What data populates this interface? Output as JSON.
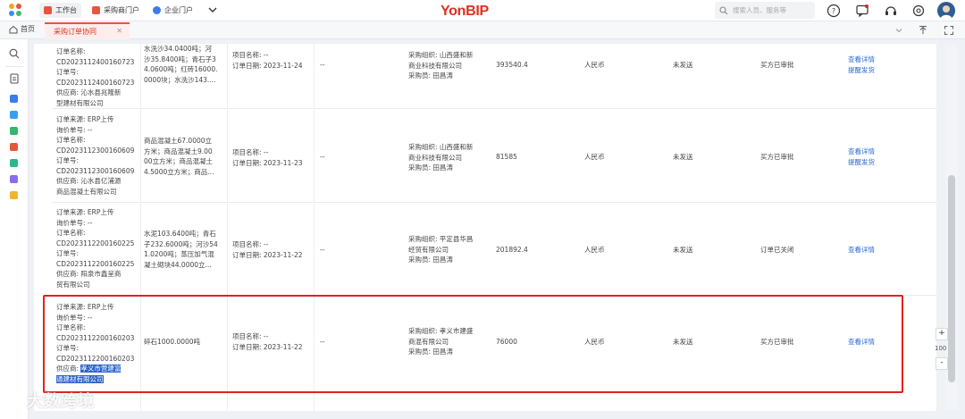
{
  "header": {
    "tabs": [
      {
        "label": "工作台"
      },
      {
        "label": "采购商门户"
      },
      {
        "label": "企业门户"
      }
    ],
    "logo": "YonBIP",
    "search_placeholder": "搜索人员、服务等"
  },
  "tabbar": {
    "home": "首页",
    "current_tab": "采购订单协同"
  },
  "rows": [
    {
      "order_info": [
        "订单名称:",
        "CD2023112400160723",
        "订单号:",
        "CD2023112400160723",
        "供应商: 沁水县兆隆新",
        "型建材有限公司"
      ],
      "product": [
        "水洗沙34.0400吨；河",
        "沙35.8400吨；青石子3",
        "4.0600吨；红砖16000.",
        "0000块；水洗沙143...."
      ],
      "project": [
        "项目名称:  --",
        "订单日期:  2023-11-24"
      ],
      "dash": "--",
      "org": [
        "采购组织: 山西盛和新",
        "商业科技有限公司",
        "采购员:  田昌涛"
      ],
      "amount": "393540.4",
      "currency": "人民币",
      "ship": "未发送",
      "status": "买方已审批",
      "actions": [
        "查看详情",
        "提醒发货"
      ]
    },
    {
      "order_info": [
        "订单来源:  ERP上传",
        "询价单号:  --",
        "订单名称:",
        "CD2023112300160609",
        "订单号:",
        "CD2023112300160609",
        "供应商:  沁水县亿浦源",
        "商品混凝土有限公司"
      ],
      "product": [
        "商品混凝土67.0000立",
        "方米；商品混凝土9.00",
        "00立方米；商品混凝土",
        "4.5000立方米；商品..."
      ],
      "project": [
        "项目名称:  --",
        "订单日期:  2023-11-23"
      ],
      "dash": "--",
      "org": [
        "采购组织: 山西盛和新",
        "商业科技有限公司",
        "采购员:  田昌涛"
      ],
      "amount": "81585",
      "currency": "人民币",
      "ship": "未发送",
      "status": "买方已审批",
      "actions": [
        "查看详情",
        "提醒发货"
      ]
    },
    {
      "order_info": [
        "订单来源:  ERP上传",
        "询价单号:  --",
        "订单名称:",
        "CD2023112200160225",
        "订单号:",
        "CD2023112200160225",
        "供应商:  阳泉市鑫呈商",
        "贸有限公司"
      ],
      "product": [
        "水泥103.6400吨；青石",
        "子232.6000吨；河沙54",
        "1.0200吨；蒸压加气混",
        "凝土砌块44.0000立..."
      ],
      "project": [
        "项目名称:  --",
        "订单日期:  2023-11-22"
      ],
      "dash": "--",
      "org": [
        "采购组织: 平定县华昌",
        "经贸有限公司",
        "采购员:  田昌涛"
      ],
      "amount": "201892.4",
      "currency": "人民币",
      "ship": "未发送",
      "status": "订单已关闭",
      "actions": [
        "查看详情"
      ]
    },
    {
      "order_info": [
        "订单来源:  ERP上传",
        "询价单号:  --",
        "订单名称:",
        "CD2023112200160203",
        "订单号:",
        "CD2023112200160203"
      ],
      "supplier_label": "供应商:",
      "supplier_hl": [
        "孝义市营建富",
        "通建材有限公司"
      ],
      "product": [
        "碎石1000.0000吨"
      ],
      "project": [
        "项目名称:  --",
        "订单日期:  2023-11-22"
      ],
      "dash": "--",
      "org": [
        "采购组织: 孝义市建盛",
        "商混有限公司",
        "采购员:  田昌涛"
      ],
      "amount": "76000",
      "currency": "人民币",
      "ship": "未发送",
      "status": "买方已审批",
      "actions": [
        "查看详情"
      ]
    }
  ],
  "zoom": {
    "plus": "+",
    "value": "100",
    "minus": "-"
  },
  "watermark": "大数跨境"
}
